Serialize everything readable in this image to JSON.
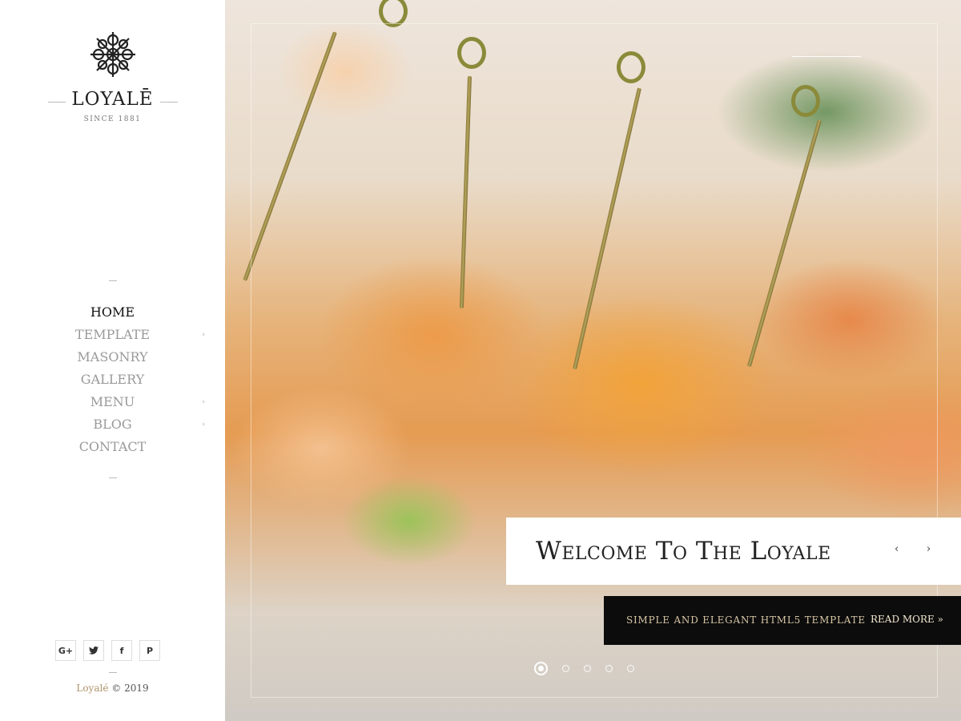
{
  "brand": {
    "name": "LOYALĒ",
    "since": "SINCE 1881"
  },
  "nav": {
    "items": [
      {
        "label": "HOME",
        "active": true,
        "has_submenu": false
      },
      {
        "label": "TEMPLATE",
        "active": false,
        "has_submenu": true
      },
      {
        "label": "MASONRY",
        "active": false,
        "has_submenu": false
      },
      {
        "label": "GALLERY",
        "active": false,
        "has_submenu": false
      },
      {
        "label": "MENU",
        "active": false,
        "has_submenu": true
      },
      {
        "label": "BLOG",
        "active": false,
        "has_submenu": true
      },
      {
        "label": "CONTACT",
        "active": false,
        "has_submenu": false
      }
    ],
    "submenu_glyph": "›"
  },
  "social": [
    {
      "icon": "google-plus-icon",
      "glyph": "G+"
    },
    {
      "icon": "twitter-icon",
      "glyph": "🐦"
    },
    {
      "icon": "facebook-icon",
      "glyph": "f"
    },
    {
      "icon": "pinterest-icon",
      "glyph": "P"
    }
  ],
  "footer": {
    "brand": "Loyalé",
    "rest": "© 2019"
  },
  "hero": {
    "title": "Welcome To The Loyale",
    "prev": "‹",
    "next": "›",
    "tagline": "SIMPLE AND ELEGANT HTML5 TEMPLATE",
    "read_more": "READ MORE »",
    "slides_total": 5,
    "slide_active": 1
  },
  "colors": {
    "accent_gold": "#b0946a",
    "tagline_bg": "#0c0c0c",
    "tagline_text": "#d8c6a6"
  }
}
